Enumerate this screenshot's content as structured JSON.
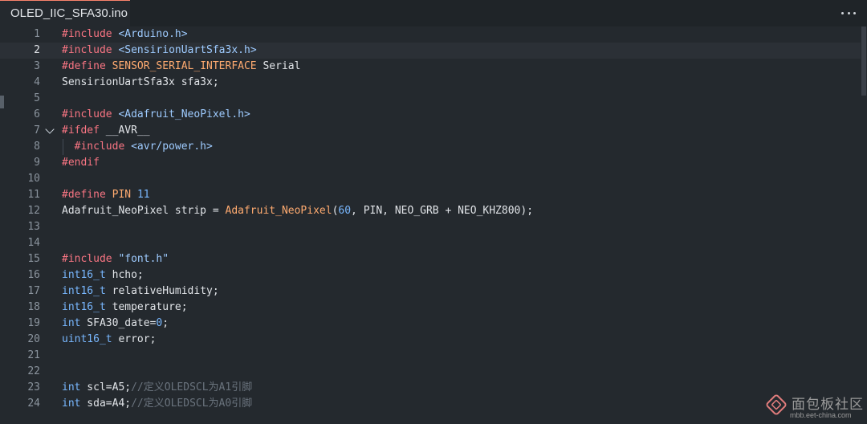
{
  "tab": {
    "title": "OLED_IIC_SFA30.ino"
  },
  "editor": {
    "lines": [
      {
        "n": "1",
        "t": [
          [
            "#include ",
            "kw"
          ],
          [
            "<Arduino.h>",
            "str"
          ]
        ]
      },
      {
        "n": "2",
        "t": [
          [
            "#include ",
            "kw"
          ],
          [
            "<SensirionUartSfa3x.h>",
            "str"
          ]
        ]
      },
      {
        "n": "3",
        "t": [
          [
            "#define ",
            "kw"
          ],
          [
            "SENSOR_SERIAL_INTERFACE",
            "mac"
          ],
          [
            " Serial",
            ""
          ]
        ]
      },
      {
        "n": "4",
        "t": [
          [
            "SensirionUartSfa3x sfa3x;",
            ""
          ]
        ]
      },
      {
        "n": "5",
        "t": []
      },
      {
        "n": "6",
        "t": [
          [
            "#include ",
            "kw"
          ],
          [
            "<Adafruit_NeoPixel.h>",
            "str"
          ]
        ]
      },
      {
        "n": "7",
        "t": [
          [
            "#ifdef ",
            "kw"
          ],
          [
            "__AVR__",
            ""
          ]
        ]
      },
      {
        "n": "8",
        "t": [
          [
            "  #include ",
            "kw"
          ],
          [
            "<avr/power.h>",
            "str"
          ]
        ]
      },
      {
        "n": "9",
        "t": [
          [
            "#endif",
            "kw"
          ]
        ]
      },
      {
        "n": "10",
        "t": []
      },
      {
        "n": "11",
        "t": [
          [
            "#define ",
            "kw"
          ],
          [
            "PIN",
            "mac"
          ],
          [
            " ",
            ""
          ],
          [
            "11",
            "num"
          ]
        ]
      },
      {
        "n": "12",
        "t": [
          [
            "Adafruit_NeoPixel strip = ",
            ""
          ],
          [
            "Adafruit_NeoPixel",
            "fn"
          ],
          [
            "(",
            ""
          ],
          [
            "60",
            "num"
          ],
          [
            ", PIN, NEO_GRB + NEO_KHZ800);",
            ""
          ]
        ]
      },
      {
        "n": "13",
        "t": []
      },
      {
        "n": "14",
        "t": []
      },
      {
        "n": "15",
        "t": [
          [
            "#include ",
            "kw"
          ],
          [
            "\"font.h\"",
            "str"
          ]
        ]
      },
      {
        "n": "16",
        "t": [
          [
            "int16_t",
            "typ"
          ],
          [
            " hcho;",
            ""
          ]
        ]
      },
      {
        "n": "17",
        "t": [
          [
            "int16_t",
            "typ"
          ],
          [
            " relativeHumidity;",
            ""
          ]
        ]
      },
      {
        "n": "18",
        "t": [
          [
            "int16_t",
            "typ"
          ],
          [
            " temperature;",
            ""
          ]
        ]
      },
      {
        "n": "19",
        "t": [
          [
            "int",
            "typ"
          ],
          [
            " SFA30_date=",
            ""
          ],
          [
            "0",
            "num"
          ],
          [
            ";",
            ""
          ]
        ]
      },
      {
        "n": "20",
        "t": [
          [
            "uint16_t",
            "typ"
          ],
          [
            " error;",
            ""
          ]
        ]
      },
      {
        "n": "21",
        "t": []
      },
      {
        "n": "22",
        "t": []
      },
      {
        "n": "23",
        "t": [
          [
            "int",
            "typ"
          ],
          [
            " scl=A5;",
            ""
          ],
          [
            "//定义OLEDSCL为A1引脚",
            "cmt"
          ]
        ]
      },
      {
        "n": "24",
        "t": [
          [
            "int",
            "typ"
          ],
          [
            " sda=A4;",
            ""
          ],
          [
            "//定义OLEDSCL为A0引脚",
            "cmt"
          ]
        ]
      }
    ]
  },
  "watermark": {
    "name": "面包板社区",
    "url": "mbb.eet-china.com"
  }
}
